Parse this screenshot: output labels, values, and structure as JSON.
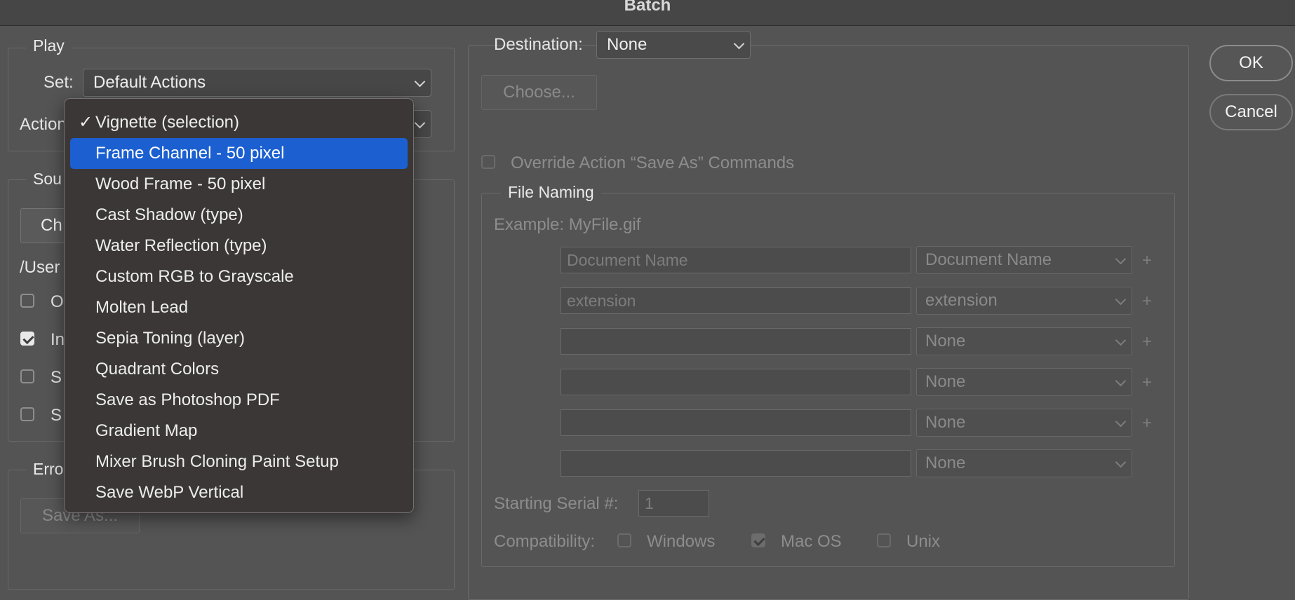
{
  "window": {
    "title": "Batch"
  },
  "play": {
    "legend": "Play",
    "set_label": "Set:",
    "set_value": "Default Actions",
    "action_label": "Action"
  },
  "source": {
    "legend": "Sou",
    "choose_label": "Ch",
    "path": "/User",
    "opt1": "O",
    "opt2": "In",
    "opt3": "S",
    "opt4": "S"
  },
  "errors": {
    "legend": "Erro",
    "save_as": "Save As..."
  },
  "destination": {
    "label": "Destination:",
    "value": "None",
    "choose": "Choose...",
    "override": "Override Action “Save As” Commands"
  },
  "file_naming": {
    "legend": "File Naming",
    "example": "Example: MyFile.gif",
    "rows": [
      {
        "field": "Document Name",
        "select": "Document Name",
        "plus": "+"
      },
      {
        "field": "extension",
        "select": "extension",
        "plus": "+"
      },
      {
        "field": "",
        "select": "None",
        "plus": "+"
      },
      {
        "field": "",
        "select": "None",
        "plus": "+"
      },
      {
        "field": "",
        "select": "None",
        "plus": "+"
      },
      {
        "field": "",
        "select": "None",
        "plus": ""
      }
    ],
    "serial_label": "Starting Serial #:",
    "serial_value": "1",
    "compat_label": "Compatibility:",
    "windows": "Windows",
    "macos": "Mac OS",
    "unix": "Unix"
  },
  "buttons": {
    "ok": "OK",
    "cancel": "Cancel"
  },
  "action_menu": {
    "checkmark": "✓",
    "items": [
      "Vignette (selection)",
      "Frame Channel - 50 pixel",
      "Wood Frame - 50 pixel",
      "Cast Shadow (type)",
      "Water Reflection (type)",
      "Custom RGB to Grayscale",
      "Molten Lead",
      "Sepia Toning (layer)",
      "Quadrant Colors",
      "Save as Photoshop PDF",
      "Gradient Map",
      "Mixer Brush Cloning Paint Setup",
      "Save WebP Vertical"
    ],
    "checked_index": 0,
    "highlighted_index": 1
  },
  "colors": {
    "background": "#545454",
    "menu_background": "#3c3737",
    "highlight": "#1b5fd0"
  }
}
